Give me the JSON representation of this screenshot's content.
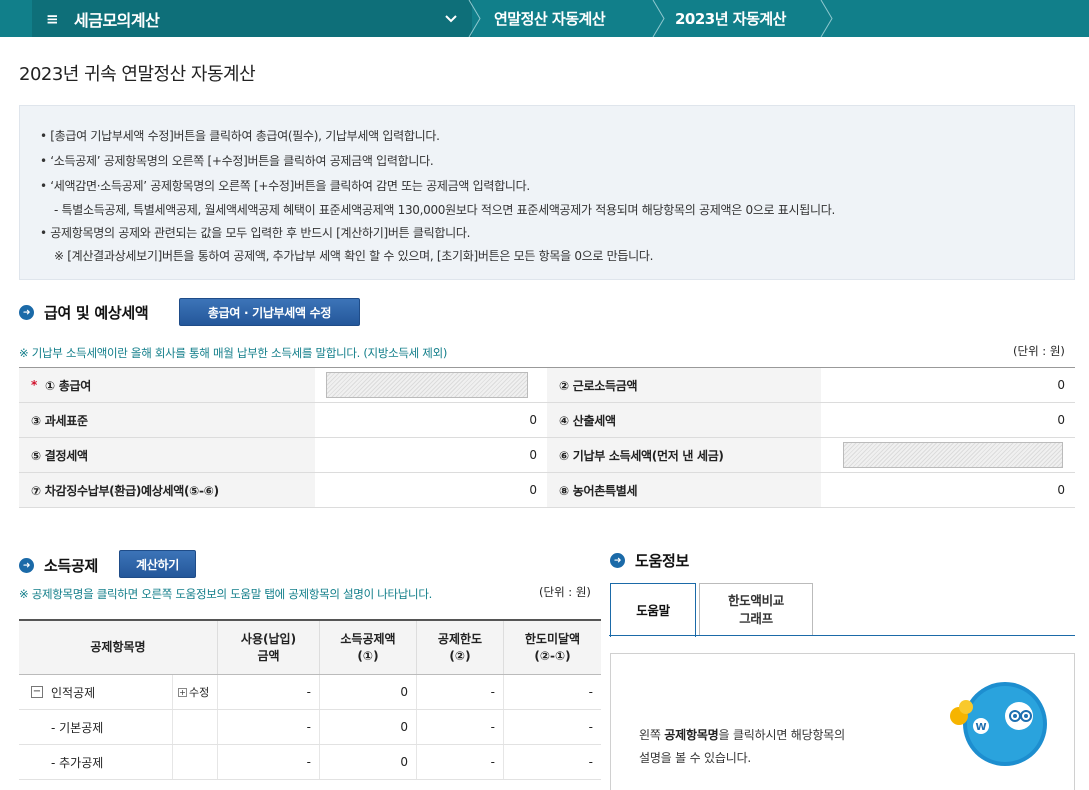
{
  "nav": {
    "menu_icon": "hamburger-icon",
    "site_title": "세금모의계산",
    "chevron_icon": "chevron-down-icon",
    "crumb1": "연말정산 자동계산",
    "crumb2": "2023년 자동계산",
    "colors": {
      "bar": "#117f8a",
      "menu_area": "#0e6f79"
    }
  },
  "page": {
    "title": "2023년 귀속 연말정산 자동계산"
  },
  "notice": {
    "lines": [
      "• [총급여 기납부세액 수정]버튼을 클릭하여 총급여(필수), 기납부세액 입력합니다.",
      "• ‘소득공제’ 공제항목명의 오른쪽 [+수정]버튼을 클릭하여 공제금액 입력합니다.",
      "• ‘세액감면·소득공제’ 공제항목명의 오른쪽 [+수정]버튼을 클릭하여 감면 또는 공제금액 입력합니다.",
      "- 특별소득공제, 특별세액공제, 월세액세액공제 혜택이 표준세액공제액 130,000원보다 적으면 표준세액공제가 적용되며 해당항목의 공제액은 0으로 표시됩니다.",
      "• 공제항목명의 공제와 관련되는 값을 모두 입력한 후 반드시 [계산하기]버튼 클릭합니다.",
      "※ [계산결과상세보기]버튼을 통하여 공제액, 추가납부 세액 확인 할 수 있으며, [초기화]버튼은 모든 항목을 0으로 만듭니다."
    ]
  },
  "salary": {
    "heading": "급여 및 예상세액",
    "edit_button": "총급여 · 기납부세액 수정",
    "note": "※ 기납부 소득세액이란 올해 회사를 통해 매월 납부한 소득세를 말합니다. (지방소득세 제외)",
    "unit": "(단위 : 원)",
    "required_mark": "*",
    "rows": [
      {
        "l1": "① 총급여",
        "v1": "",
        "l2": "② 근로소득금액",
        "v2": "0"
      },
      {
        "l1": "③ 과세표준",
        "v1": "0",
        "l2": "④ 산출세액",
        "v2": "0"
      },
      {
        "l1": "⑤ 결정세액",
        "v1": "0",
        "l2": "⑥ 기납부 소득세액(먼저 낸 세금)",
        "v2": ""
      },
      {
        "l1": "⑦ 차감징수납부(환급)예상세액(⑤-⑥)",
        "v1": "0",
        "l2": "⑧ 농어촌특별세",
        "v2": "0"
      }
    ]
  },
  "deduction": {
    "heading": "소득공제",
    "calc_button": "계산하기",
    "note": "※ 공제항목명을 클릭하면 오른쪽 도움정보의 도움말 탭에 공제항목의 설명이 나타납니다.",
    "unit": "(단위 : 원)",
    "columns": [
      "공제항목명",
      "사용(납입)\n금액",
      "소득공제액\n(①)",
      "공제한도\n(②)",
      "한도미달액\n(②-①)"
    ],
    "edit_label": "수정",
    "rows": [
      {
        "name": "인적공제",
        "used": "-",
        "amount": "0",
        "limit": "-",
        "short": "-"
      },
      {
        "name": "- 기본공제",
        "used": "-",
        "amount": "0",
        "limit": "-",
        "short": "-"
      },
      {
        "name": "- 추가공제",
        "used": "-",
        "amount": "0",
        "limit": "-",
        "short": "-"
      }
    ]
  },
  "help": {
    "heading": "도움정보",
    "tabs": [
      "도움말",
      "한도액비교\n그래프"
    ],
    "text_pre": "왼쪽 ",
    "text_bold": "공제항목명",
    "text_post": "을 클릭하시면 해당항목의",
    "text_line2": "설명을 볼 수 있습니다.",
    "mascot_letter": "W"
  }
}
